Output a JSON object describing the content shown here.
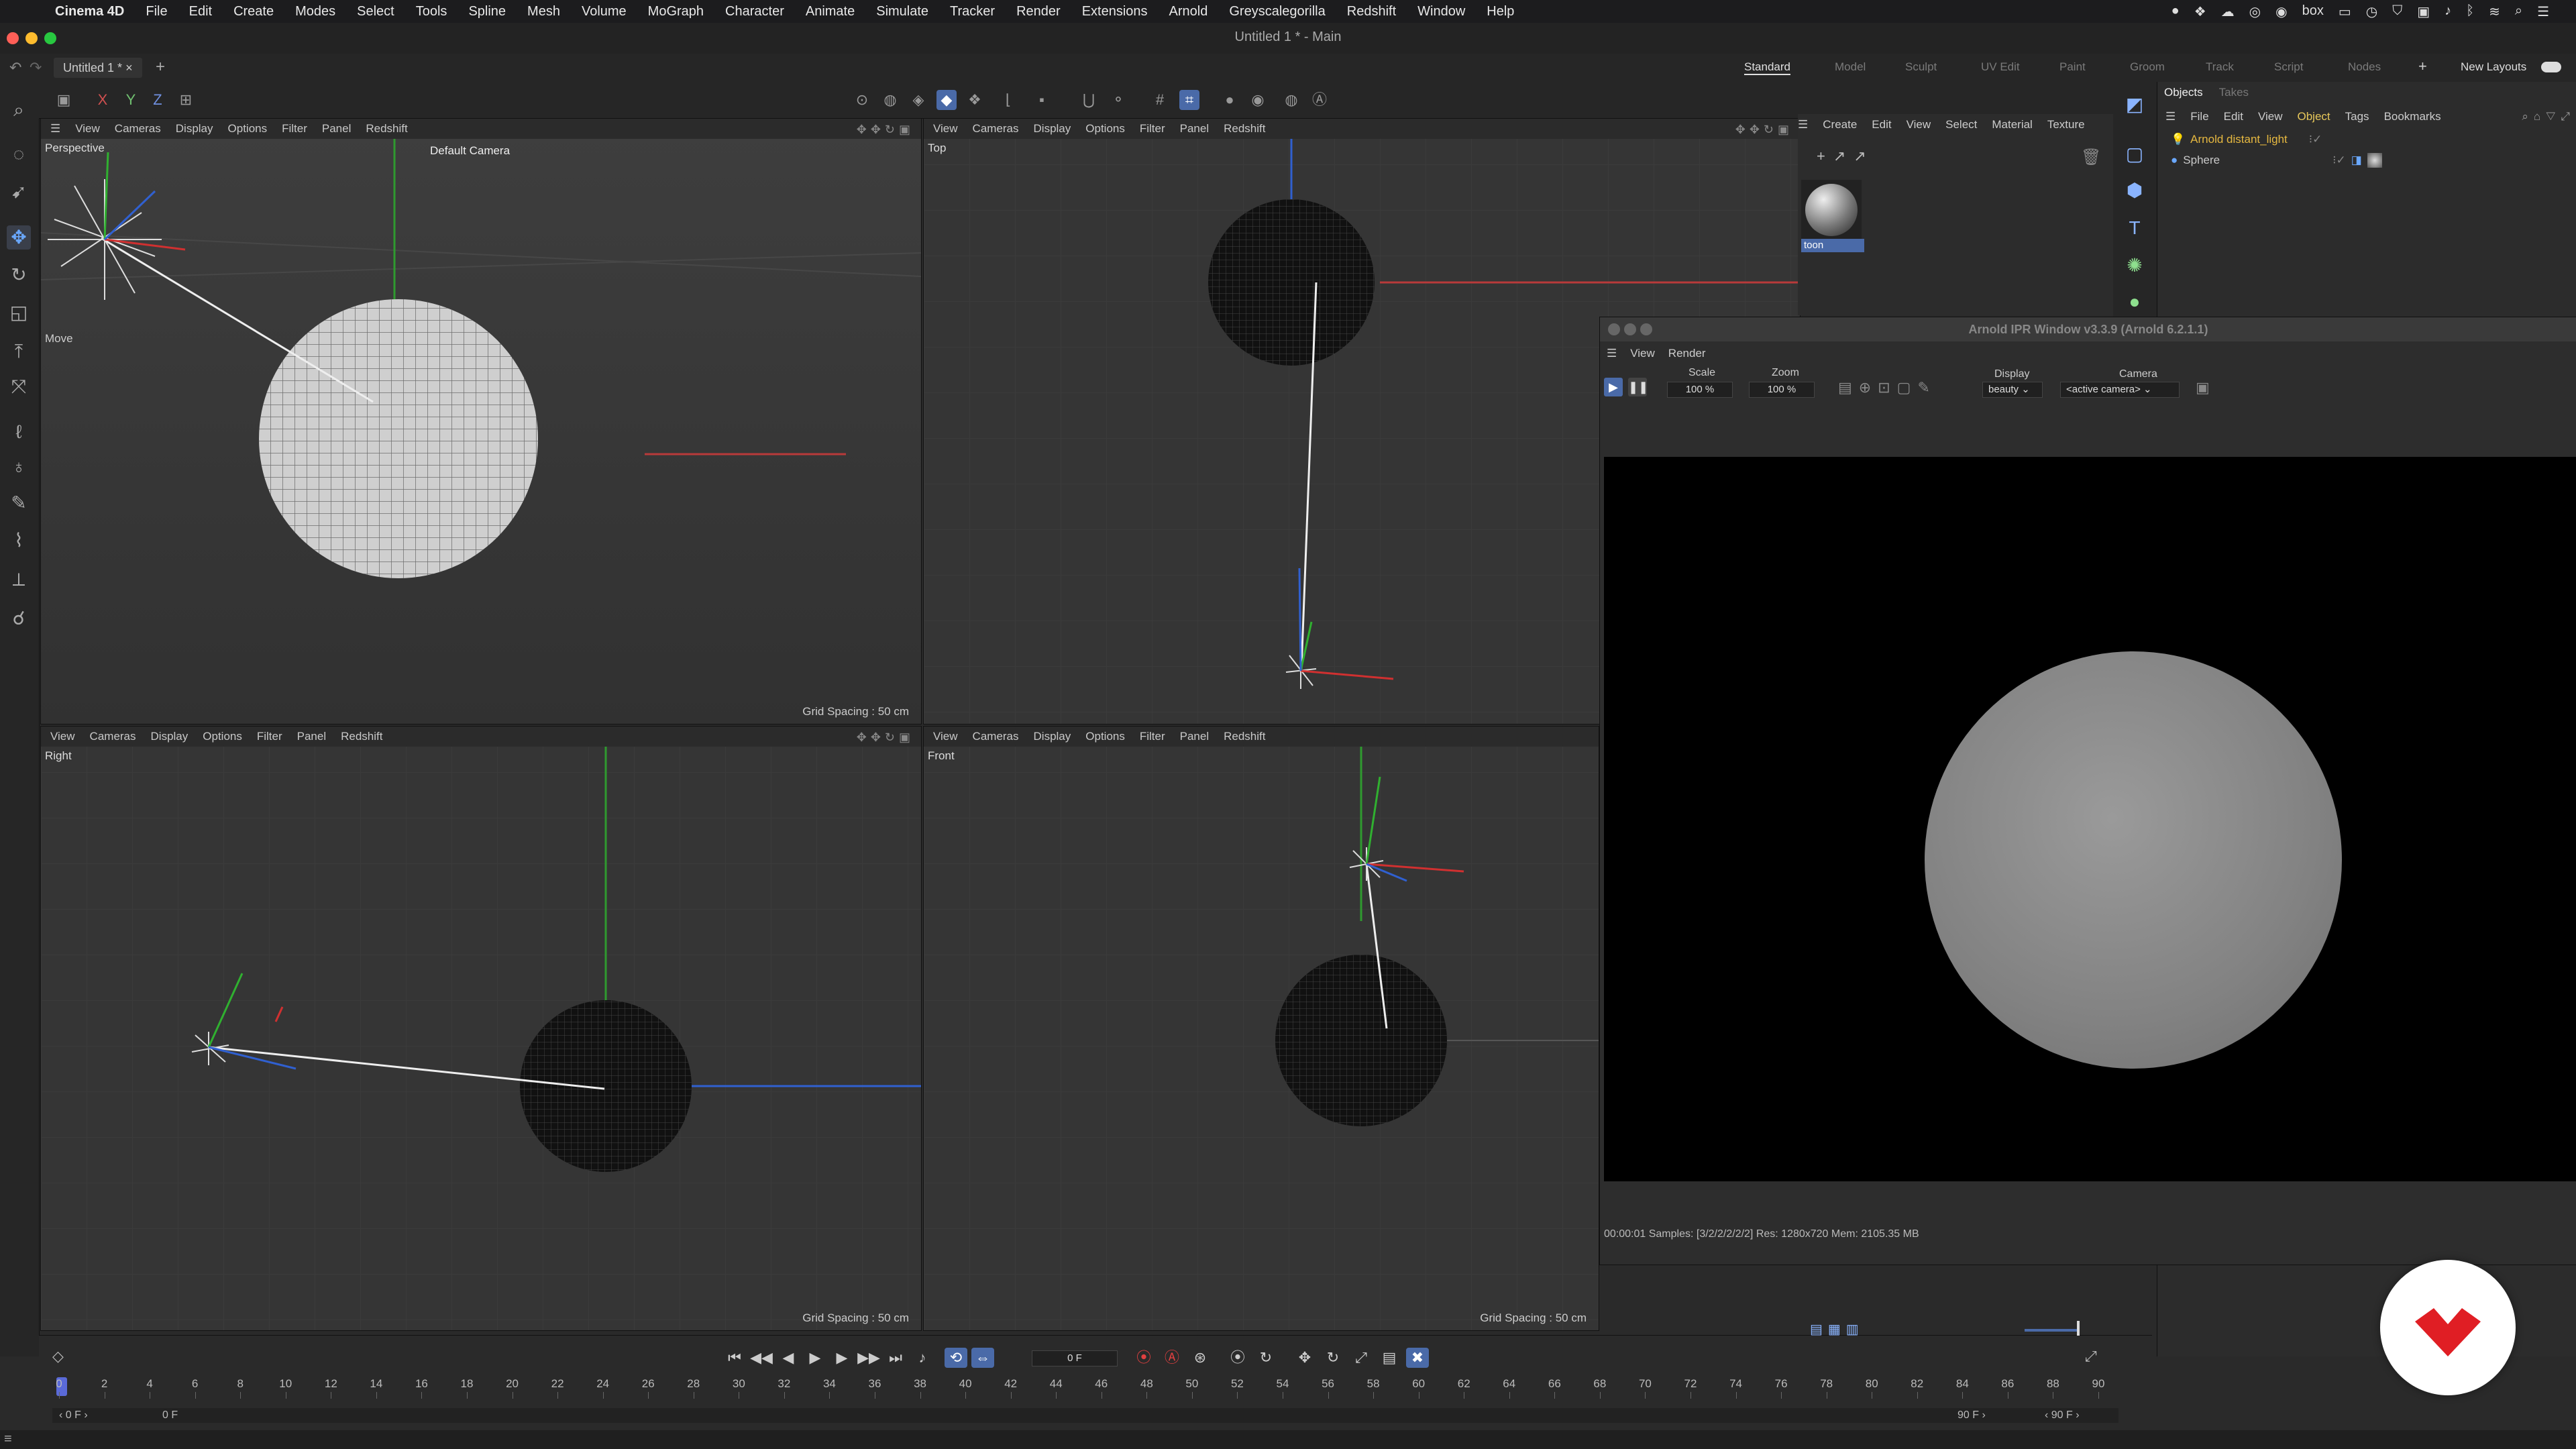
{
  "menubar": {
    "app": "Cinema 4D",
    "items": [
      "File",
      "Edit",
      "Create",
      "Modes",
      "Select",
      "Tools",
      "Spline",
      "Mesh",
      "Volume",
      "MoGraph",
      "Character",
      "Animate",
      "Simulate",
      "Tracker",
      "Render",
      "Extensions",
      "Arnold",
      "Greyscalegorilla",
      "Redshift",
      "Window",
      "Help"
    ],
    "tray_box": "box"
  },
  "window": {
    "title": "Untitled 1 * - Main"
  },
  "tabs": {
    "doc": "Untitled 1 *",
    "add": "+"
  },
  "layouts": {
    "items": [
      "Standard",
      "Model",
      "Sculpt",
      "UV Edit",
      "Paint",
      "Groom",
      "Track",
      "Script",
      "Nodes"
    ],
    "active": "Standard",
    "new_layouts": "New Layouts"
  },
  "toptools": {
    "x": "X",
    "y": "Y",
    "z": "Z"
  },
  "viewports": {
    "menu": [
      "View",
      "Cameras",
      "Display",
      "Options",
      "Filter",
      "Panel",
      "Redshift"
    ],
    "perspective": {
      "label": "Perspective",
      "camera": "Default Camera ",
      "move": "Move",
      "grid": "Grid Spacing : 50 cm"
    },
    "top": {
      "label": "Top"
    },
    "right": {
      "label": "Right",
      "grid": "Grid Spacing : 50 cm"
    },
    "front": {
      "label": "Front",
      "grid": "Grid Spacing : 50 cm"
    }
  },
  "material_manager": {
    "menu": [
      "Create",
      "Edit",
      "View",
      "Select",
      "Material",
      "Texture"
    ],
    "material_name": "toon"
  },
  "object_manager": {
    "tabs": [
      "Objects",
      "Takes"
    ],
    "menu": [
      "File",
      "Edit",
      "View",
      "Object",
      "Tags",
      "Bookmarks"
    ],
    "objects": [
      {
        "name": "Arnold distant_light",
        "color": "#e6b840"
      },
      {
        "name": "Sphere",
        "color": "#ddd"
      }
    ]
  },
  "ipr": {
    "title": "Arnold IPR Window v3.3.9 (Arnold 6.2.1.1)",
    "menu": [
      "View",
      "Render"
    ],
    "scale_label": "Scale",
    "scale_value": "100 %",
    "zoom_label": "Zoom",
    "zoom_value": "100 %",
    "display_label": "Display",
    "display_value": "beauty",
    "camera_label": "Camera",
    "camera_value": "<active camera>",
    "status": "00:00:01  Samples: [3/2/2/2/2/2]  Res: 1280x720  Mem: 2105.35 MB"
  },
  "timeline": {
    "current_frame": "0 F",
    "ticks": [
      "0",
      "2",
      "4",
      "6",
      "8",
      "10",
      "12",
      "14",
      "16",
      "18",
      "20",
      "22",
      "24",
      "26",
      "28",
      "30",
      "32",
      "34",
      "36",
      "38",
      "40",
      "42",
      "44",
      "46",
      "48",
      "50",
      "52",
      "54",
      "56",
      "58",
      "60",
      "62",
      "64",
      "66",
      "68",
      "70",
      "72",
      "74",
      "76",
      "78",
      "80",
      "82",
      "84",
      "86",
      "88",
      "90"
    ],
    "start": "0 F",
    "start2": "0 F",
    "end": "90 F",
    "end2": "90 F"
  },
  "colors": {
    "accent": "#4a6aa8",
    "x_axis": "#d03030",
    "y_axis": "#30b030",
    "z_axis": "#3060d0",
    "logo_red": "#e01e24"
  }
}
